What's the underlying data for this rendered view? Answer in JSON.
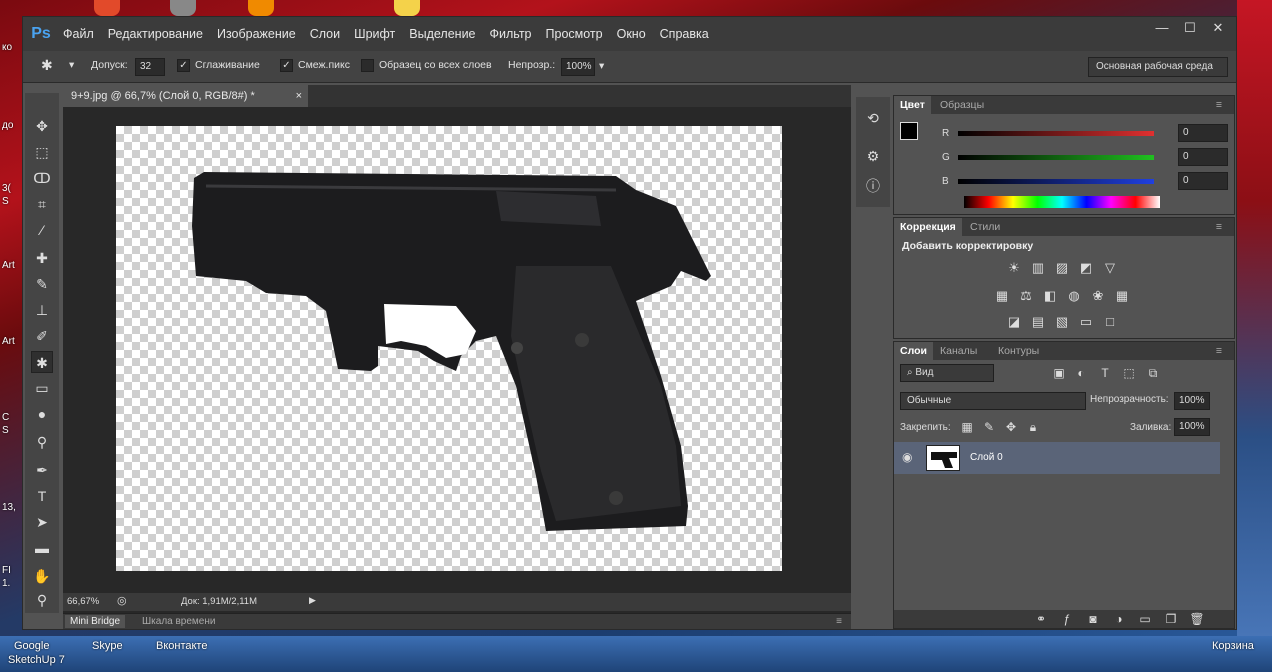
{
  "desktop": {
    "left_labels": [
      "ко",
      "до",
      "3(",
      "S",
      "Art",
      "Art",
      "C",
      "S",
      "13,",
      "FI",
      "1."
    ],
    "bottom_labels": [
      "Google",
      "SketchUp 7",
      "Skype",
      "Вконтакте",
      "Корзина"
    ]
  },
  "app": {
    "logo": "Ps",
    "menu": [
      "Файл",
      "Редактирование",
      "Изображение",
      "Слои",
      "Шрифт",
      "Выделение",
      "Фильтр",
      "Просмотр",
      "Окно",
      "Справка"
    ],
    "window_controls": [
      "—",
      "☐",
      "✕"
    ]
  },
  "options": {
    "tolerance_label": "Допуск:",
    "tolerance_value": "32",
    "antialias_label": "Сглаживание",
    "contiguous_label": "Смеж.пикс",
    "sample_all_label": "Образец со всех слоев",
    "opacity_label": "Непрозр.:",
    "opacity_value": "100%",
    "workspace": "Основная рабочая среда"
  },
  "document": {
    "tab_title": "9+9.jpg @ 66,7% (Слой 0, RGB/8#) *",
    "zoom": "66,67%",
    "doc_size": "Док: 1,91M/2,11M"
  },
  "bottom_panel_tabs": [
    "Mini Bridge",
    "Шкала времени"
  ],
  "color_panel": {
    "tabs": [
      "Цвет",
      "Образцы"
    ],
    "channels": [
      {
        "label": "R",
        "value": "0"
      },
      {
        "label": "G",
        "value": "0"
      },
      {
        "label": "B",
        "value": "0"
      }
    ],
    "colors": {
      "r": "#e03030",
      "g": "#20c020",
      "b": "#2040e0"
    }
  },
  "adjust_panel": {
    "tabs": [
      "Коррекция",
      "Стили"
    ],
    "title": "Добавить корректировку",
    "icons_row1": [
      "brightness-icon",
      "levels-icon",
      "curves-icon",
      "exposure-icon",
      "vibrance-icon"
    ],
    "icons_row2": [
      "hue-sat-icon",
      "color-balance-icon",
      "bw-icon",
      "photo-filter-icon",
      "channel-mixer-icon",
      "color-lookup-icon"
    ],
    "icons_row3": [
      "invert-icon",
      "posterize-icon",
      "threshold-icon",
      "gradient-map-icon",
      "selective-color-icon"
    ]
  },
  "layers_panel": {
    "tabs": [
      "Слои",
      "Каналы",
      "Контуры"
    ],
    "filter_label": "Вид",
    "blend_mode": "Обычные",
    "opacity_label": "Непрозрачность:",
    "opacity_value": "100%",
    "lock_label": "Закрепить:",
    "fill_label": "Заливка:",
    "fill_value": "100%",
    "layers": [
      {
        "name": "Слой 0",
        "visible": true
      }
    ]
  }
}
